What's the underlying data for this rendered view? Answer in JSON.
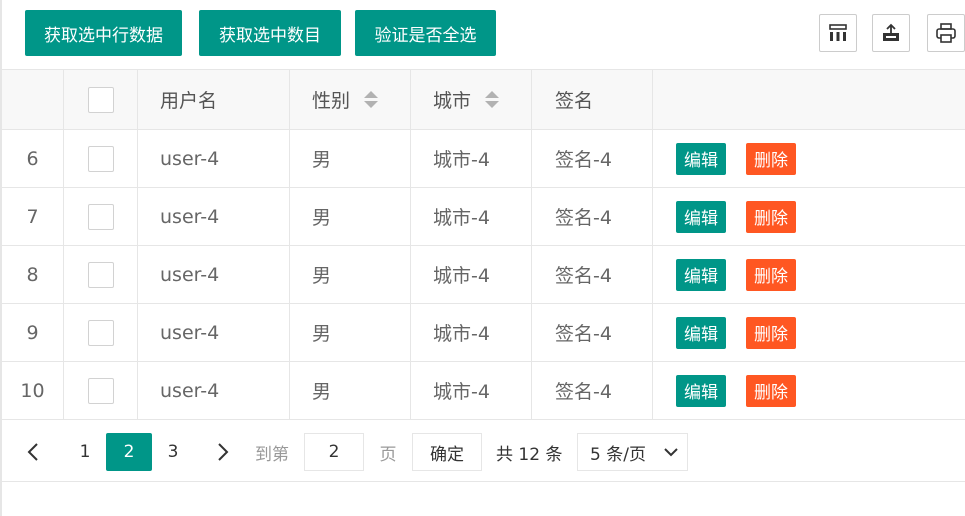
{
  "toolbar": {
    "buttons": [
      "获取选中行数据",
      "获取选中数目",
      "验证是否全选"
    ],
    "icons": [
      "columns-icon",
      "export-icon",
      "print-icon"
    ]
  },
  "table": {
    "headers": {
      "username": "用户名",
      "sex": "性别",
      "city": "城市",
      "sign": "签名"
    },
    "rows": [
      {
        "index": "6",
        "username": "user-4",
        "sex": "男",
        "city": "城市-4",
        "sign": "签名-4"
      },
      {
        "index": "7",
        "username": "user-4",
        "sex": "男",
        "city": "城市-4",
        "sign": "签名-4"
      },
      {
        "index": "8",
        "username": "user-4",
        "sex": "男",
        "city": "城市-4",
        "sign": "签名-4"
      },
      {
        "index": "9",
        "username": "user-4",
        "sex": "男",
        "city": "城市-4",
        "sign": "签名-4"
      },
      {
        "index": "10",
        "username": "user-4",
        "sex": "男",
        "city": "城市-4",
        "sign": "签名-4"
      }
    ],
    "actions": {
      "edit": "编辑",
      "delete": "删除"
    }
  },
  "pagination": {
    "pages": [
      "1",
      "2",
      "3"
    ],
    "current": "2",
    "goto_label": "到第",
    "goto_value": "2",
    "page_unit": "页",
    "confirm": "确定",
    "total": "共 12 条",
    "page_size": "5 条/页"
  },
  "colors": {
    "primary": "#009688",
    "danger": "#ff5722",
    "border": "#e6e6e6"
  }
}
